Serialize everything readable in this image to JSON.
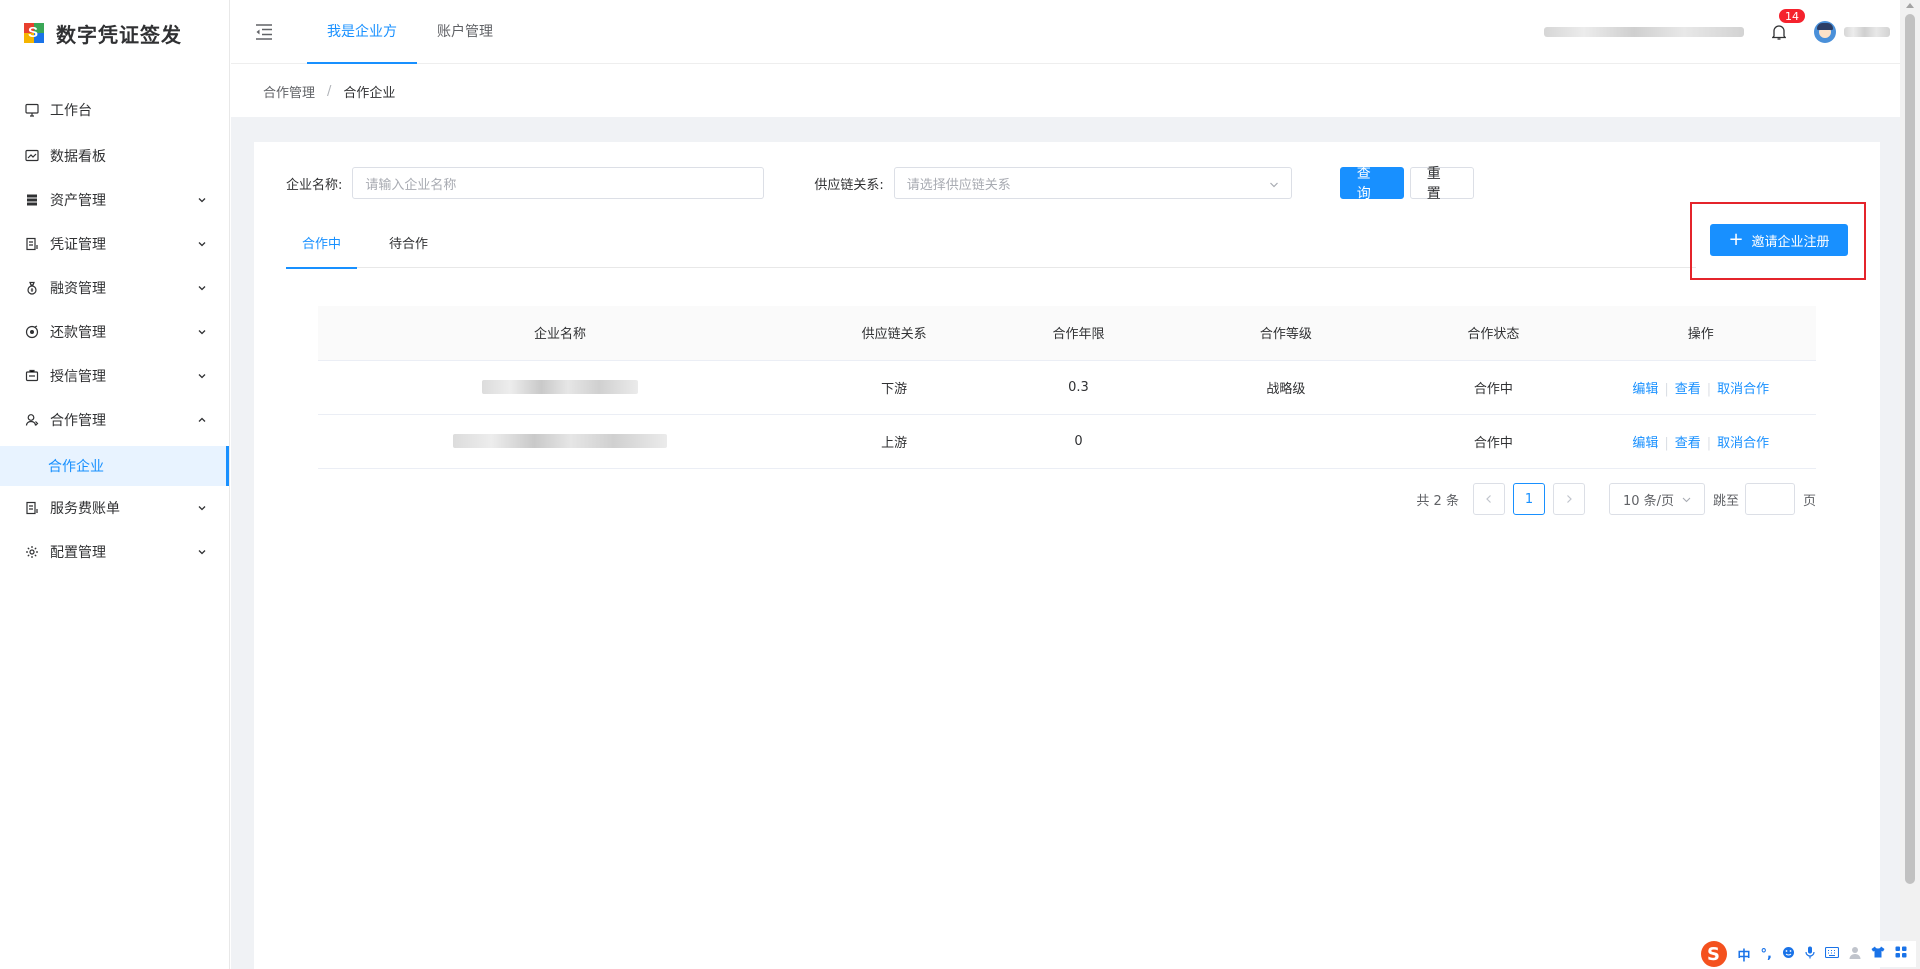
{
  "app": {
    "title": "数字凭证签发"
  },
  "sidebar": {
    "items": [
      {
        "label": "工作台",
        "icon": "monitor-icon",
        "expandable": false
      },
      {
        "label": "数据看板",
        "icon": "chart-board-icon",
        "expandable": false
      },
      {
        "label": "资产管理",
        "icon": "database-icon",
        "expandable": true
      },
      {
        "label": "凭证管理",
        "icon": "document-list-icon",
        "expandable": true
      },
      {
        "label": "融资管理",
        "icon": "money-bag-icon",
        "expandable": true
      },
      {
        "label": "还款管理",
        "icon": "repay-icon",
        "expandable": true
      },
      {
        "label": "授信管理",
        "icon": "credit-card-icon",
        "expandable": true
      },
      {
        "label": "合作管理",
        "icon": "partner-icon",
        "expandable": true,
        "expanded": true
      },
      {
        "label": "合作企业",
        "active": true
      },
      {
        "label": "服务费账单",
        "icon": "bill-icon",
        "expandable": true
      },
      {
        "label": "配置管理",
        "icon": "gear-icon",
        "expandable": true
      }
    ]
  },
  "header": {
    "tabs": [
      {
        "label": "我是企业方",
        "active": true
      },
      {
        "label": "账户管理",
        "active": false
      }
    ],
    "notification_count": "14"
  },
  "breadcrumb": {
    "parent": "合作管理",
    "separator": "/",
    "current": "合作企业"
  },
  "search": {
    "name_label": "企业名称:",
    "name_placeholder": "请输入企业名称",
    "chain_label": "供应链关系:",
    "chain_placeholder": "请选择供应链关系",
    "query_label": "查询",
    "reset_label": "重置"
  },
  "tabs": [
    {
      "label": "合作中",
      "active": true
    },
    {
      "label": "待合作",
      "active": false
    }
  ],
  "invite_button": {
    "label": "邀请企业注册"
  },
  "table": {
    "columns": [
      "企业名称",
      "供应链关系",
      "合作年限",
      "合作等级",
      "合作状态",
      "操作"
    ],
    "rows": [
      {
        "chain": "下游",
        "years": "0.3",
        "level": "战略级",
        "status": "合作中"
      },
      {
        "chain": "上游",
        "years": "0",
        "level": "",
        "status": "合作中"
      }
    ],
    "actions": {
      "edit": "编辑",
      "view": "查看",
      "cancel": "取消合作"
    }
  },
  "pagination": {
    "total_text": "共 2 条",
    "current_page": "1",
    "page_size": "10 条/页",
    "jump_label": "跳至",
    "page_unit": "页"
  },
  "ime": {
    "logo": "S",
    "lang": "中",
    "punct": "°,"
  },
  "colors": {
    "primary": "#1890ff",
    "highlight_border": "#e4242b",
    "badge": "#f5222d"
  }
}
